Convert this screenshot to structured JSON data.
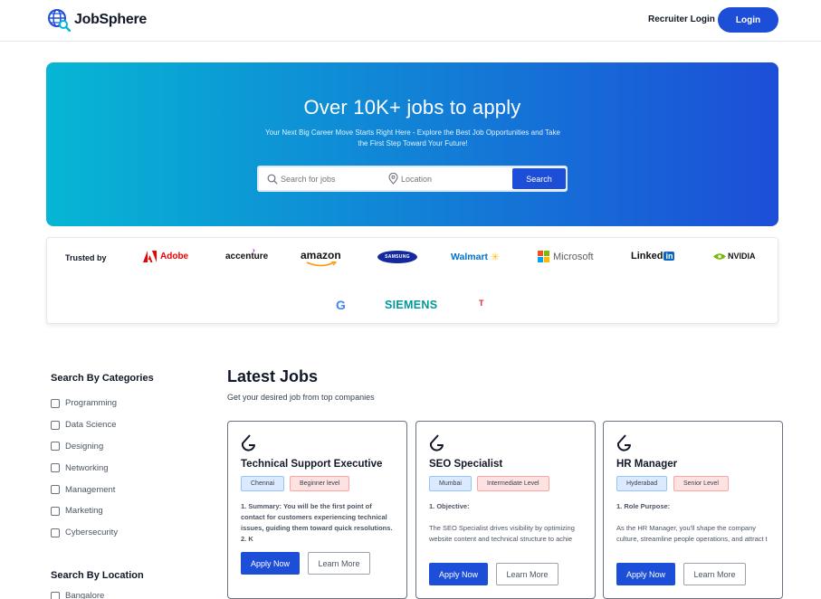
{
  "header": {
    "brand_name": "JobSphere",
    "recruiter_login": "Recruiter Login",
    "login": "Login"
  },
  "hero": {
    "title": "Over 10K+ jobs to apply",
    "subtitle": "Your Next Big Career Move Starts Right Here - Explore the Best Job Opportunities and Take the First Step Toward Your Future!",
    "search_placeholder": "Search for jobs",
    "location_placeholder": "Location",
    "search_button": "Search"
  },
  "trusted": {
    "label": "Trusted by",
    "logos": {
      "adobe": "Adobe",
      "accenture": "accenture",
      "amazon": "amazon",
      "samsung": "SAMSUNG",
      "walmart": "Walmart",
      "microsoft": "Microsoft",
      "linkedin_left": "Linked",
      "linkedin_right": "in",
      "nvidia": "NVIDIA",
      "google": "G",
      "siemens": "SIEMENS",
      "tesla": "T"
    }
  },
  "sidebar": {
    "categories_title": "Search By Categories",
    "categories": [
      "Programming",
      "Data Science",
      "Designing",
      "Networking",
      "Management",
      "Marketing",
      "Cybersecurity"
    ],
    "location_title": "Search By Location",
    "locations": [
      "Bangalore"
    ]
  },
  "jobs": {
    "title": "Latest Jobs",
    "subtitle": "Get your desired job from top companies",
    "apply_label": "Apply Now",
    "learn_label": "Learn More",
    "cards": [
      {
        "title": "Technical Support Executive",
        "location": "Chennai",
        "level": "Beginner level",
        "desc_bold": "1. Summary: You will be the first point of contact for customers experiencing technical issues, guiding them toward quick resolutions. 2. K",
        "desc_text": ""
      },
      {
        "title": "SEO Specialist",
        "location": "Mumbai",
        "level": "Intermediate Level",
        "desc_bold": "1. Objective:",
        "desc_text": "The SEO Specialist drives visibility by optimizing website content and technical structure to achie"
      },
      {
        "title": "HR Manager",
        "location": "Hyderabad",
        "level": "Senior Level",
        "desc_bold": "1. Role Purpose:",
        "desc_text": "As the HR Manager, you'll shape the company culture, streamline people operations, and attract t"
      }
    ]
  },
  "colors": {
    "primary": "#1d4ed8",
    "hero_start": "#06b6d4",
    "hero_end": "#1d4ed8"
  }
}
